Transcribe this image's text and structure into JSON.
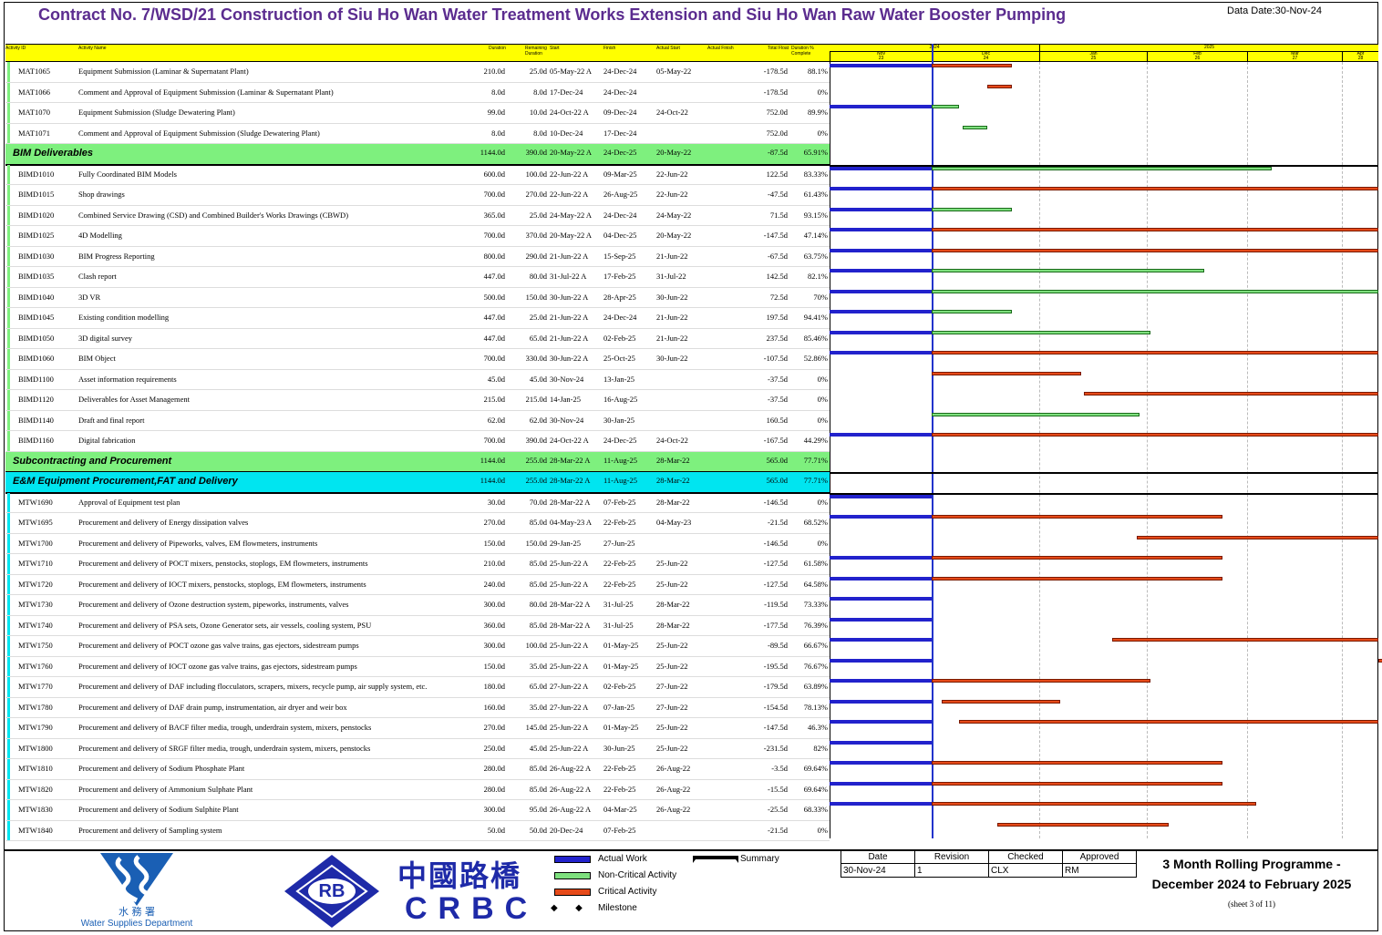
{
  "title": "Contract No. 7/WSD/21 Construction of Siu Ho Wan Water Treatment Works Extension and Siu Ho Wan Raw Water Booster Pumping",
  "data_date": "Data Date:30-Nov-24",
  "columns": [
    "Activity ID",
    "Activity Name",
    "Duration",
    "Remaining Duration",
    "Start",
    "Finish",
    "Actual Start",
    "Actual Finish",
    "Total Float",
    "Duration % Complete"
  ],
  "timeline": {
    "years": [
      "2024",
      "2025"
    ],
    "months": [
      {
        "name": "Nov",
        "week": "23"
      },
      {
        "name": "Dec",
        "week": "24"
      },
      {
        "name": "Jan",
        "week": "25"
      },
      {
        "name": "Feb",
        "week": "26"
      },
      {
        "name": "Mar",
        "week": "27"
      },
      {
        "name": "Apr",
        "week": "28"
      }
    ]
  },
  "rows": [
    {
      "type": "act",
      "id": "MAT1065",
      "name": "Equipment Submission (Laminar & Supernatant Plant)",
      "dur": "210.0d",
      "rem": "25.0d",
      "start": "05-May-22 A",
      "finish": "24-Dec-24",
      "as": "05-May-22",
      "af": "",
      "tf": "-178.5d",
      "pc": "88.1%"
    },
    {
      "type": "act",
      "id": "MAT1066",
      "name": "Comment and Approval of Equipment Submission (Laminar & Supernatant Plant)",
      "dur": "8.0d",
      "rem": "8.0d",
      "start": "17-Dec-24",
      "finish": "24-Dec-24",
      "as": "",
      "af": "",
      "tf": "-178.5d",
      "pc": "0%"
    },
    {
      "type": "act",
      "id": "MAT1070",
      "name": "Equipment Submission (Sludge Dewatering Plant)",
      "dur": "99.0d",
      "rem": "10.0d",
      "start": "24-Oct-22 A",
      "finish": "09-Dec-24",
      "as": "24-Oct-22",
      "af": "",
      "tf": "752.0d",
      "pc": "89.9%"
    },
    {
      "type": "act",
      "id": "MAT1071",
      "name": "Comment and Approval of Equipment Submission (Sludge Dewatering Plant)",
      "dur": "8.0d",
      "rem": "8.0d",
      "start": "10-Dec-24",
      "finish": "17-Dec-24",
      "as": "",
      "af": "",
      "tf": "752.0d",
      "pc": "0%"
    },
    {
      "type": "grp",
      "color": "#7ef07e",
      "id": "BIM Deliverables",
      "name": "",
      "dur": "1144.0d",
      "rem": "390.0d",
      "start": "20-May-22 A",
      "finish": "24-Dec-25",
      "as": "20-May-22",
      "af": "",
      "tf": "-87.5d",
      "pc": "65.91%"
    },
    {
      "type": "act",
      "id": "BIMD1010",
      "name": "Fully Coordinated BIM Models",
      "dur": "600.0d",
      "rem": "100.0d",
      "start": "22-Jun-22 A",
      "finish": "09-Mar-25",
      "as": "22-Jun-22",
      "af": "",
      "tf": "122.5d",
      "pc": "83.33%"
    },
    {
      "type": "act",
      "id": "BIMD1015",
      "name": "Shop drawings",
      "dur": "700.0d",
      "rem": "270.0d",
      "start": "22-Jun-22 A",
      "finish": "26-Aug-25",
      "as": "22-Jun-22",
      "af": "",
      "tf": "-47.5d",
      "pc": "61.43%"
    },
    {
      "type": "act",
      "id": "BIMD1020",
      "name": "Combined Service Drawing (CSD) and Combined Builder's Works Drawings (CBWD)",
      "dur": "365.0d",
      "rem": "25.0d",
      "start": "24-May-22 A",
      "finish": "24-Dec-24",
      "as": "24-May-22",
      "af": "",
      "tf": "71.5d",
      "pc": "93.15%"
    },
    {
      "type": "act",
      "id": "BIMD1025",
      "name": "4D Modelling",
      "dur": "700.0d",
      "rem": "370.0d",
      "start": "20-May-22 A",
      "finish": "04-Dec-25",
      "as": "20-May-22",
      "af": "",
      "tf": "-147.5d",
      "pc": "47.14%"
    },
    {
      "type": "act",
      "id": "BIMD1030",
      "name": "BIM Progress Reporting",
      "dur": "800.0d",
      "rem": "290.0d",
      "start": "21-Jun-22 A",
      "finish": "15-Sep-25",
      "as": "21-Jun-22",
      "af": "",
      "tf": "-67.5d",
      "pc": "63.75%"
    },
    {
      "type": "act",
      "id": "BIMD1035",
      "name": "Clash report",
      "dur": "447.0d",
      "rem": "80.0d",
      "start": "31-Jul-22 A",
      "finish": "17-Feb-25",
      "as": "31-Jul-22",
      "af": "",
      "tf": "142.5d",
      "pc": "82.1%"
    },
    {
      "type": "act",
      "id": "BIMD1040",
      "name": "3D VR",
      "dur": "500.0d",
      "rem": "150.0d",
      "start": "30-Jun-22 A",
      "finish": "28-Apr-25",
      "as": "30-Jun-22",
      "af": "",
      "tf": "72.5d",
      "pc": "70%"
    },
    {
      "type": "act",
      "id": "BIMD1045",
      "name": "Existing condition modelling",
      "dur": "447.0d",
      "rem": "25.0d",
      "start": "21-Jun-22 A",
      "finish": "24-Dec-24",
      "as": "21-Jun-22",
      "af": "",
      "tf": "197.5d",
      "pc": "94.41%"
    },
    {
      "type": "act",
      "id": "BIMD1050",
      "name": "3D digital survey",
      "dur": "447.0d",
      "rem": "65.0d",
      "start": "21-Jun-22 A",
      "finish": "02-Feb-25",
      "as": "21-Jun-22",
      "af": "",
      "tf": "237.5d",
      "pc": "85.46%"
    },
    {
      "type": "act",
      "id": "BIMD1060",
      "name": "BIM Object",
      "dur": "700.0d",
      "rem": "330.0d",
      "start": "30-Jun-22 A",
      "finish": "25-Oct-25",
      "as": "30-Jun-22",
      "af": "",
      "tf": "-107.5d",
      "pc": "52.86%"
    },
    {
      "type": "act",
      "id": "BIMD1100",
      "name": "Asset information requirements",
      "dur": "45.0d",
      "rem": "45.0d",
      "start": "30-Nov-24",
      "finish": "13-Jan-25",
      "as": "",
      "af": "",
      "tf": "-37.5d",
      "pc": "0%"
    },
    {
      "type": "act",
      "id": "BIMD1120",
      "name": "Deliverables for Asset Management",
      "dur": "215.0d",
      "rem": "215.0d",
      "start": "14-Jan-25",
      "finish": "16-Aug-25",
      "as": "",
      "af": "",
      "tf": "-37.5d",
      "pc": "0%"
    },
    {
      "type": "act",
      "id": "BIMD1140",
      "name": "Draft and final report",
      "dur": "62.0d",
      "rem": "62.0d",
      "start": "30-Nov-24",
      "finish": "30-Jan-25",
      "as": "",
      "af": "",
      "tf": "160.5d",
      "pc": "0%"
    },
    {
      "type": "act",
      "id": "BIMD1160",
      "name": "Digital fabrication",
      "dur": "700.0d",
      "rem": "390.0d",
      "start": "24-Oct-22 A",
      "finish": "24-Dec-25",
      "as": "24-Oct-22",
      "af": "",
      "tf": "-167.5d",
      "pc": "44.29%"
    },
    {
      "type": "grp",
      "color": "#7ef07e",
      "id": "Subcontracting and Procurement",
      "name": "",
      "dur": "1144.0d",
      "rem": "255.0d",
      "start": "28-Mar-22 A",
      "finish": "11-Aug-25",
      "as": "28-Mar-22",
      "af": "",
      "tf": "565.0d",
      "pc": "77.71%"
    },
    {
      "type": "grp",
      "color": "#00e5f0",
      "id": "E&M Equipment Procurement,FAT and Delivery",
      "name": "",
      "dur": "1144.0d",
      "rem": "255.0d",
      "start": "28-Mar-22 A",
      "finish": "11-Aug-25",
      "as": "28-Mar-22",
      "af": "",
      "tf": "565.0d",
      "pc": "77.71%"
    },
    {
      "type": "act",
      "id": "MTW1690",
      "name": "Approval of Equipment test plan",
      "dur": "30.0d",
      "rem": "70.0d",
      "start": "28-Mar-22 A",
      "finish": "07-Feb-25",
      "as": "28-Mar-22",
      "af": "",
      "tf": "-146.5d",
      "pc": "0%"
    },
    {
      "type": "act",
      "id": "MTW1695",
      "name": "Procurement and delivery of Energy dissipation valves",
      "dur": "270.0d",
      "rem": "85.0d",
      "start": "04-May-23 A",
      "finish": "22-Feb-25",
      "as": "04-May-23",
      "af": "",
      "tf": "-21.5d",
      "pc": "68.52%"
    },
    {
      "type": "act",
      "id": "MTW1700",
      "name": "Procurement and delivery of Pipeworks, valves, EM flowmeters, instruments",
      "dur": "150.0d",
      "rem": "150.0d",
      "start": "29-Jan-25",
      "finish": "27-Jun-25",
      "as": "",
      "af": "",
      "tf": "-146.5d",
      "pc": "0%"
    },
    {
      "type": "act",
      "id": "MTW1710",
      "name": "Procurement and delivery of POCT mixers, penstocks, stoplogs, EM flowmeters, instruments",
      "dur": "210.0d",
      "rem": "85.0d",
      "start": "25-Jun-22 A",
      "finish": "22-Feb-25",
      "as": "25-Jun-22",
      "af": "",
      "tf": "-127.5d",
      "pc": "61.58%"
    },
    {
      "type": "act",
      "id": "MTW1720",
      "name": "Procurement and delivery of IOCT mixers, penstocks, stoplogs, EM flowmeters, instruments",
      "dur": "240.0d",
      "rem": "85.0d",
      "start": "25-Jun-22 A",
      "finish": "22-Feb-25",
      "as": "25-Jun-22",
      "af": "",
      "tf": "-127.5d",
      "pc": "64.58%"
    },
    {
      "type": "act",
      "id": "MTW1730",
      "name": "Procurement and delivery of Ozone destruction system, pipeworks, instruments, valves",
      "dur": "300.0d",
      "rem": "80.0d",
      "start": "28-Mar-22 A",
      "finish": "31-Jul-25",
      "as": "28-Mar-22",
      "af": "",
      "tf": "-119.5d",
      "pc": "73.33%"
    },
    {
      "type": "act",
      "id": "MTW1740",
      "name": "Procurement and delivery of PSA sets, Ozone Generator sets, air vessels, cooling system, PSU",
      "dur": "360.0d",
      "rem": "85.0d",
      "start": "28-Mar-22 A",
      "finish": "31-Jul-25",
      "as": "28-Mar-22",
      "af": "",
      "tf": "-177.5d",
      "pc": "76.39%"
    },
    {
      "type": "act",
      "id": "MTW1750",
      "name": "Procurement and delivery of POCT ozone gas valve trains, gas ejectors, sidestream pumps",
      "dur": "300.0d",
      "rem": "100.0d",
      "start": "25-Jun-22 A",
      "finish": "01-May-25",
      "as": "25-Jun-22",
      "af": "",
      "tf": "-89.5d",
      "pc": "66.67%"
    },
    {
      "type": "act",
      "id": "MTW1760",
      "name": "Procurement and delivery of IOCT ozone gas valve trains, gas ejectors, sidestream pumps",
      "dur": "150.0d",
      "rem": "35.0d",
      "start": "25-Jun-22 A",
      "finish": "01-May-25",
      "as": "25-Jun-22",
      "af": "",
      "tf": "-195.5d",
      "pc": "76.67%"
    },
    {
      "type": "act",
      "id": "MTW1770",
      "name": "Procurement and delivery of DAF including flocculators, scrapers, mixers, recycle pump, air supply system, etc.",
      "dur": "180.0d",
      "rem": "65.0d",
      "start": "27-Jun-22 A",
      "finish": "02-Feb-25",
      "as": "27-Jun-22",
      "af": "",
      "tf": "-179.5d",
      "pc": "63.89%"
    },
    {
      "type": "act",
      "id": "MTW1780",
      "name": "Procurement and delivery of DAF drain pump, instrumentation, air dryer and weir box",
      "dur": "160.0d",
      "rem": "35.0d",
      "start": "27-Jun-22 A",
      "finish": "07-Jan-25",
      "as": "27-Jun-22",
      "af": "",
      "tf": "-154.5d",
      "pc": "78.13%"
    },
    {
      "type": "act",
      "id": "MTW1790",
      "name": "Procurement and delivery of BACF filter media, trough, underdrain system, mixers, penstocks",
      "dur": "270.0d",
      "rem": "145.0d",
      "start": "25-Jun-22 A",
      "finish": "01-May-25",
      "as": "25-Jun-22",
      "af": "",
      "tf": "-147.5d",
      "pc": "46.3%"
    },
    {
      "type": "act",
      "id": "MTW1800",
      "name": "Procurement and delivery of SRGF filter media, trough, underdrain system, mixers, penstocks",
      "dur": "250.0d",
      "rem": "45.0d",
      "start": "25-Jun-22 A",
      "finish": "30-Jun-25",
      "as": "25-Jun-22",
      "af": "",
      "tf": "-231.5d",
      "pc": "82%"
    },
    {
      "type": "act",
      "id": "MTW1810",
      "name": "Procurement and delivery of Sodium Phosphate Plant",
      "dur": "280.0d",
      "rem": "85.0d",
      "start": "26-Aug-22 A",
      "finish": "22-Feb-25",
      "as": "26-Aug-22",
      "af": "",
      "tf": "-3.5d",
      "pc": "69.64%"
    },
    {
      "type": "act",
      "id": "MTW1820",
      "name": "Procurement and delivery of Ammonium Sulphate Plant",
      "dur": "280.0d",
      "rem": "85.0d",
      "start": "26-Aug-22 A",
      "finish": "22-Feb-25",
      "as": "26-Aug-22",
      "af": "",
      "tf": "-15.5d",
      "pc": "69.64%"
    },
    {
      "type": "act",
      "id": "MTW1830",
      "name": "Procurement and delivery of Sodium Sulphite Plant",
      "dur": "300.0d",
      "rem": "95.0d",
      "start": "26-Aug-22 A",
      "finish": "04-Mar-25",
      "as": "26-Aug-22",
      "af": "",
      "tf": "-25.5d",
      "pc": "68.33%"
    },
    {
      "type": "act",
      "id": "MTW1840",
      "name": "Procurement and delivery of Sampling system",
      "dur": "50.0d",
      "rem": "50.0d",
      "start": "20-Dec-24",
      "finish": "07-Feb-25",
      "as": "",
      "af": "",
      "tf": "-21.5d",
      "pc": "0%"
    }
  ],
  "bars": [
    {
      "blue": true,
      "kind": "red",
      "s": "Dec 1",
      "e": "Dec 24"
    },
    {
      "blue": false,
      "kind": "red",
      "s": "Dec 17",
      "e": "Dec 24"
    },
    {
      "blue": true,
      "kind": "green",
      "s": "Dec 1",
      "e": "Dec 9"
    },
    {
      "blue": false,
      "kind": "green",
      "s": "Dec 10",
      "e": "Dec 17"
    },
    null,
    {
      "blue": true,
      "kind": "green",
      "s": "Dec 1",
      "e": "Mar 9"
    },
    {
      "blue": true,
      "kind": "red",
      "s": "Dec 1",
      "e": "Apr 30"
    },
    {
      "blue": true,
      "kind": "green",
      "s": "Dec 1",
      "e": "Dec 24"
    },
    {
      "blue": true,
      "kind": "red",
      "s": "Dec 1",
      "e": "Apr 30"
    },
    {
      "blue": true,
      "kind": "red",
      "s": "Dec 1",
      "e": "Apr 30"
    },
    {
      "blue": true,
      "kind": "green",
      "s": "Dec 1",
      "e": "Feb 17"
    },
    {
      "blue": true,
      "kind": "green",
      "s": "Dec 1",
      "e": "Apr 30"
    },
    {
      "blue": true,
      "kind": "green",
      "s": "Dec 1",
      "e": "Dec 24"
    },
    {
      "blue": true,
      "kind": "green",
      "s": "Dec 1",
      "e": "Feb 2"
    },
    {
      "blue": true,
      "kind": "red",
      "s": "Dec 1",
      "e": "Apr 30"
    },
    {
      "blue": false,
      "kind": "red",
      "s": "Dec 1",
      "e": "Jan 13"
    },
    {
      "blue": false,
      "kind": "red",
      "s": "Jan 14",
      "e": "Apr 30"
    },
    {
      "blue": false,
      "kind": "green",
      "s": "Dec 1",
      "e": "Jan 30"
    },
    {
      "blue": true,
      "kind": "red",
      "s": "Dec 1",
      "e": "Apr 30"
    },
    null,
    null,
    {
      "blue": true,
      "kind": "none"
    },
    {
      "blue": true,
      "kind": "red",
      "s": "Dec 1",
      "e": "Feb 22"
    },
    {
      "blue": false,
      "kind": "red",
      "s": "Jan 29",
      "e": "Apr 30"
    },
    {
      "blue": true,
      "kind": "red",
      "s": "Dec 1",
      "e": "Feb 22"
    },
    {
      "blue": true,
      "kind": "red",
      "s": "Dec 1",
      "e": "Feb 22"
    },
    {
      "blue": true,
      "kind": "none"
    },
    {
      "blue": true,
      "kind": "none"
    },
    {
      "blue": true,
      "kind": "red",
      "s": "Jan 22",
      "e": "Apr 30"
    },
    {
      "blue": true,
      "kind": "red",
      "s": "Apr 19",
      "e": "Apr 30"
    },
    {
      "blue": true,
      "kind": "red",
      "s": "Dec 1",
      "e": "Feb 2"
    },
    {
      "blue": true,
      "kind": "red",
      "s": "Dec 4",
      "e": "Jan 7"
    },
    {
      "blue": true,
      "kind": "red",
      "s": "Dec 9",
      "e": "Apr 30"
    },
    {
      "blue": true,
      "kind": "none"
    },
    {
      "blue": true,
      "kind": "red",
      "s": "Dec 1",
      "e": "Feb 22"
    },
    {
      "blue": true,
      "kind": "red",
      "s": "Dec 1",
      "e": "Feb 22"
    },
    {
      "blue": true,
      "kind": "red",
      "s": "Dec 1",
      "e": "Mar 4"
    },
    {
      "blue": false,
      "kind": "red",
      "s": "Dec 20",
      "e": "Feb 7"
    }
  ],
  "legend": {
    "actual": "Actual Work",
    "noncritical": "Non-Critical Activity",
    "critical": "Critical Activity",
    "milestone": "Milestone",
    "summary": "Summary"
  },
  "colors": {
    "actual": "#2222cc",
    "noncritical": "#7ee07e",
    "critical": "#e64a19",
    "header": "#ffff00",
    "group_green": "#7ef07e",
    "group_cyan": "#00e5f0",
    "title": "#5b2c8f"
  },
  "wsd": {
    "chinese": "水 務 署",
    "english": "Water Supplies Department"
  },
  "crbc": {
    "emblem": "RB",
    "chinese": "中國路橋",
    "latin": "CRBC"
  },
  "signoff": {
    "headers": [
      "Date",
      "Revision",
      "Checked",
      "Approved"
    ],
    "values": [
      "30-Nov-24",
      "1",
      "CLX",
      "RM"
    ]
  },
  "programme": {
    "line1": "3 Month Rolling Programme -",
    "line2": "December 2024 to February 2025",
    "sheet": "(sheet 3 of 11)"
  }
}
